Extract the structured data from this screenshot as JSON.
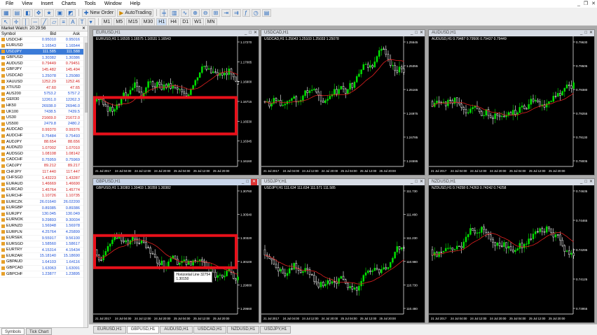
{
  "menu": [
    "File",
    "View",
    "Insert",
    "Charts",
    "Tools",
    "Window",
    "Help"
  ],
  "toolbar": {
    "new_order": "New Order",
    "autotrading": "AutoTrading",
    "timeframes": [
      "M1",
      "M5",
      "M15",
      "M30",
      "H1",
      "H4",
      "D1",
      "W1",
      "MN"
    ]
  },
  "market_watch": {
    "title": "Market Watch: 20:29:56",
    "cols": [
      "Symbol",
      "Bid",
      "Ask"
    ],
    "rows": [
      {
        "s": "USDCHF",
        "b": "0.95010",
        "a": "0.95016",
        "d": false
      },
      {
        "s": "EURUSD",
        "b": "1.16543",
        "a": "1.16544",
        "d": false
      },
      {
        "s": "USDJPY",
        "b": "111.585",
        "a": "111.588",
        "d": false,
        "sel": true
      },
      {
        "s": "GBPUSD",
        "b": "1.30382",
        "a": "1.30386",
        "d": false
      },
      {
        "s": "AUDUSD",
        "b": "0.79449",
        "a": "0.79451",
        "d": true
      },
      {
        "s": "GBPJPY",
        "b": "145.482",
        "a": "145.494",
        "d": true
      },
      {
        "s": "USDCAD",
        "b": "1.25078",
        "a": "1.25080",
        "d": false
      },
      {
        "s": "XAUUSD",
        "b": "1252.29",
        "a": "1252.46",
        "d": true
      },
      {
        "s": "XTIUSD",
        "b": "47.60",
        "a": "47.65",
        "d": true
      },
      {
        "s": "AUS200",
        "b": "5753.2",
        "a": "5757.2",
        "d": false
      },
      {
        "s": "GER30",
        "b": "12261.0",
        "a": "12262.3",
        "d": false
      },
      {
        "s": "HK50",
        "b": "26938.0",
        "a": "26946.0",
        "d": false
      },
      {
        "s": "UK100",
        "b": "7438.5",
        "a": "7439.5",
        "d": false
      },
      {
        "s": "US30",
        "b": "21669.0",
        "a": "21672.0",
        "d": true
      },
      {
        "s": "US500",
        "b": "2479.8",
        "a": "2480.2",
        "d": false
      },
      {
        "s": "AUDCAD",
        "b": "0.99370",
        "a": "0.99376",
        "d": true
      },
      {
        "s": "AUDCHF",
        "b": "0.75484",
        "a": "0.75493",
        "d": false
      },
      {
        "s": "AUDJPY",
        "b": "88.654",
        "a": "88.656",
        "d": true
      },
      {
        "s": "AUDNZD",
        "b": "1.07002",
        "a": "1.07010",
        "d": true
      },
      {
        "s": "AUDSGD",
        "b": "1.08108",
        "a": "1.08142",
        "d": true
      },
      {
        "s": "CADCHF",
        "b": "0.75959",
        "a": "0.75969",
        "d": false
      },
      {
        "s": "CADJPY",
        "b": "89.212",
        "a": "89.217",
        "d": true
      },
      {
        "s": "CHFJPY",
        "b": "117.440",
        "a": "117.447",
        "d": true
      },
      {
        "s": "CHFSGD",
        "b": "1.43223",
        "a": "1.43287",
        "d": true
      },
      {
        "s": "EURAUD",
        "b": "1.46669",
        "a": "1.46690",
        "d": true
      },
      {
        "s": "EURCAD",
        "b": "1.45764",
        "a": "1.45774",
        "d": true
      },
      {
        "s": "EURCHF",
        "b": "1.10726",
        "a": "1.10735",
        "d": true
      },
      {
        "s": "EURCZK",
        "b": "26.01640",
        "a": "26.02200",
        "d": false
      },
      {
        "s": "EURGBP",
        "b": "0.89385",
        "a": "0.89386",
        "d": false
      },
      {
        "s": "EURJPY",
        "b": "130.045",
        "a": "130.049",
        "d": false
      },
      {
        "s": "EURNOK",
        "b": "9.29893",
        "a": "9.30034",
        "d": false
      },
      {
        "s": "EURNZD",
        "b": "1.56948",
        "a": "1.56978",
        "d": false
      },
      {
        "s": "EURPLN",
        "b": "4.25764",
        "a": "4.25899",
        "d": false
      },
      {
        "s": "EURSEK",
        "b": "9.55917",
        "a": "9.56100",
        "d": false
      },
      {
        "s": "EURSGD",
        "b": "1.58560",
        "a": "1.58617",
        "d": false
      },
      {
        "s": "EURTRY",
        "b": "4.15314",
        "a": "4.15434",
        "d": false
      },
      {
        "s": "EURZAR",
        "b": "15.18140",
        "a": "15.18690",
        "d": false
      },
      {
        "s": "GBPAUD",
        "b": "1.64103",
        "a": "1.64116",
        "d": false
      },
      {
        "s": "GBPCAD",
        "b": "1.63063",
        "a": "1.63091",
        "d": false
      },
      {
        "s": "GBPCHF",
        "b": "1.23877",
        "a": "1.23895",
        "d": false
      }
    ],
    "tabs": [
      "Symbols",
      "Tick Chart"
    ]
  },
  "charts": [
    {
      "id": "eurusd",
      "title": "EURUSD,H1",
      "hdr": "EURUSD,H1  1.16535 1.16575 1.16531 1.16543",
      "ticks": [
        "1.17270",
        "1.17085",
        "1.16900",
        "1.16715",
        "1.16530",
        "1.16345",
        "1.16160"
      ],
      "xlab": [
        "21 Jul 2017",
        "24 Jul 04:00",
        "24 Jul 12:00",
        "24 Jul 20:00",
        "25 Jul 04:00",
        "25 Jul 12:00",
        "25 Jul 20:00"
      ],
      "seed": 3,
      "box": true
    },
    {
      "id": "usdcad",
      "title": "USDCAD,H1",
      "hdr": "USDCAD,H1  1.25043 1.25103 1.25033 1.25078",
      "ticks": [
        "1.25545",
        "1.25355",
        "1.25165",
        "1.24975",
        "1.24785",
        "1.24595"
      ],
      "xlab": [
        "21 Jul 2017",
        "24 Jul 04:00",
        "24 Jul 12:00",
        "24 Jul 20:00",
        "25 Jul 04:00",
        "25 Jul 12:00",
        "25 Jul 20:00"
      ],
      "seed": 7,
      "box": false
    },
    {
      "id": "audusd",
      "title": "AUDUSD,H1",
      "hdr": "AUDUSD,H1  0.79487 0.79506 0.79437 0.79449",
      "ticks": [
        "0.79630",
        "0.79505",
        "0.79380",
        "0.79255",
        "0.79130",
        "0.79005"
      ],
      "xlab": [
        "21 Jul 2017",
        "24 Jul 04:00",
        "24 Jul 12:00",
        "24 Jul 20:00",
        "25 Jul 04:00",
        "25 Jul 12:00",
        "25 Jul 20:00"
      ],
      "seed": 11,
      "box": false
    },
    {
      "id": "gbpusd",
      "title": "GBPUSD,H1",
      "hdr": "GBPUSD,H1  1.30383 1.30403 1.30359 1.30382",
      "ticks": [
        "1.30760",
        "1.30540",
        "1.30320",
        "1.30100",
        "1.29880",
        "1.29660"
      ],
      "xlab": [
        "21 Jul 2017",
        "24 Jul 04:00",
        "24 Jul 12:00",
        "24 Jul 20:00",
        "25 Jul 04:00",
        "25 Jul 12:00",
        "25 Jul 20:00"
      ],
      "seed": 17,
      "box": true,
      "tip": [
        "Horizontal Line 32754",
        "1.30150"
      ]
    },
    {
      "id": "usdjpy",
      "title": "USDJPY,H1",
      "hdr": "USDJPY,H1  111.634 111.634 111.571 111.585",
      "ticks": [
        "111.730",
        "111.480",
        "111.230",
        "110.980",
        "110.730",
        "110.480"
      ],
      "xlab": [
        "21 Jul 2017",
        "24 Jul 04:00",
        "24 Jul 12:00",
        "24 Jul 20:00",
        "25 Jul 04:00",
        "25 Jul 12:00",
        "25 Jul 20:00"
      ],
      "seed": 23,
      "box": false
    },
    {
      "id": "nzdusd",
      "title": "NZDUSD,H1",
      "hdr": "NZDUSD,H1  0.74258 0.74263 0.74242 0.74258",
      "ticks": [
        "0.74635",
        "0.74465",
        "0.74295",
        "0.74125",
        "0.73955"
      ],
      "xlab": [
        "21 Jul 2017",
        "24 Jul 04:00",
        "24 Jul 12:00",
        "24 Jul 20:00",
        "25 Jul 04:00",
        "25 Jul 12:00",
        "25 Jul 20:00"
      ],
      "seed": 29,
      "box": false
    }
  ],
  "tabs": [
    "EURUSD,H1",
    "GBPUSD,H1",
    "AUDUSD,H1",
    "USDCAD,H1",
    "NZDUSD,H1",
    "USDJPY,H1"
  ],
  "colors": {
    "bull": "#00e000",
    "bear": "#ffffff",
    "ma": "#e02020",
    "box": "#e8101a",
    "axis": "#ffffff",
    "bg": "#000000"
  }
}
